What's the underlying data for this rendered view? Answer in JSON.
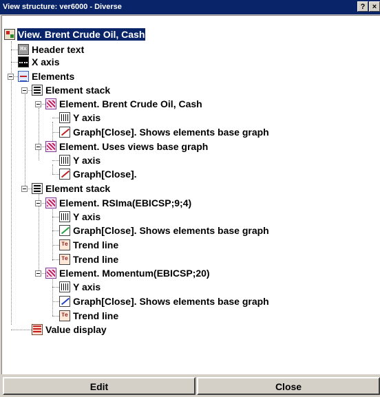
{
  "window": {
    "title": "View structure: ver6000 - Diverse",
    "help_label": "?",
    "close_label": "×"
  },
  "tree": {
    "root": {
      "label": "View. Brent Crude Oil, Cash",
      "icon": "view-icon",
      "selected": true
    },
    "header_text": {
      "label": "Header text",
      "icon_text": "Hx"
    },
    "x_axis": {
      "label": "X axis"
    },
    "elements": {
      "label": "Elements"
    },
    "stack1": {
      "label": "Element stack",
      "element1": {
        "label": "Element. Brent Crude Oil, Cash",
        "y_axis": "Y axis",
        "graph": "Graph[Close]. Shows elements base graph"
      },
      "element2": {
        "label": "Element. Uses views base graph",
        "y_axis": "Y axis",
        "graph": "Graph[Close]."
      }
    },
    "stack2": {
      "label": "Element stack",
      "element1": {
        "label": "Element. RSIma(EBICSP;9;4)",
        "y_axis": "Y axis",
        "graph": "Graph[Close]. Shows elements base graph",
        "trend1": "Trend line",
        "trend2": "Trend line"
      },
      "element2": {
        "label": "Element. Momentum(EBICSP;20)",
        "y_axis": "Y axis",
        "graph": "Graph[Close]. Shows elements base graph",
        "trend1": "Trend line"
      }
    },
    "value_display": {
      "label": "Value display"
    },
    "trend_icon_text": "Te"
  },
  "footer": {
    "edit_label": "Edit",
    "close_label": "Close"
  }
}
